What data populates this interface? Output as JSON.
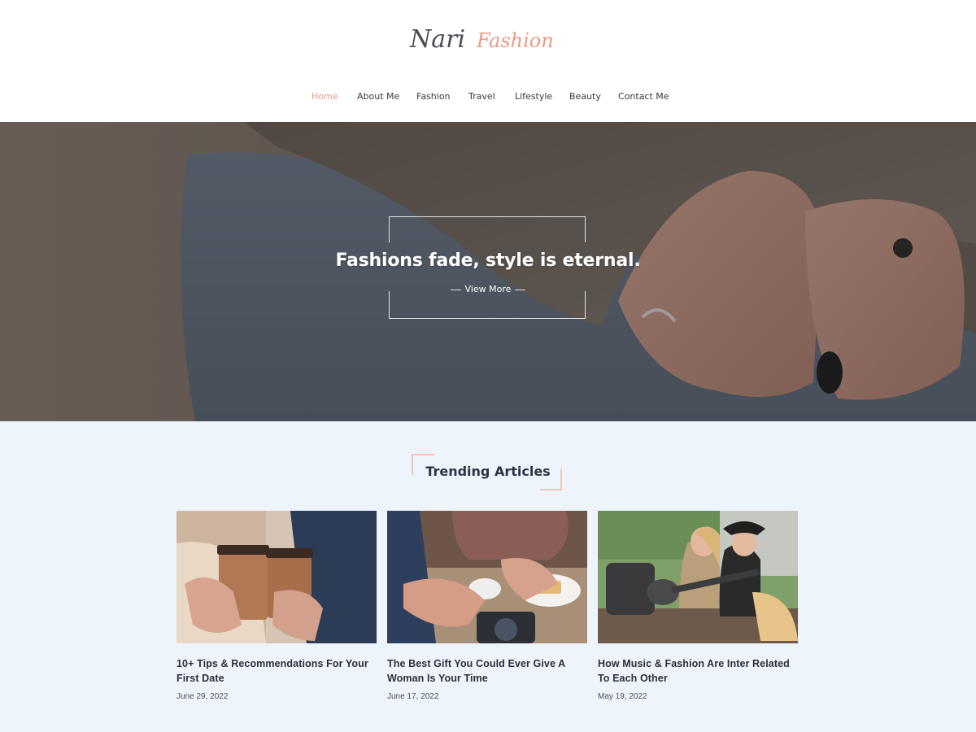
{
  "logo": {
    "text_part1": "Nari",
    "text_part2": "Fashion"
  },
  "nav": {
    "items": [
      {
        "label": "Home",
        "active": true
      },
      {
        "label": "About Me",
        "active": false
      },
      {
        "label": "Fashion",
        "active": false
      },
      {
        "label": "Travel",
        "active": false
      },
      {
        "label": "Lifestyle",
        "active": false
      },
      {
        "label": "Beauty",
        "active": false
      },
      {
        "label": "Contact Me",
        "active": false
      }
    ]
  },
  "hero": {
    "title": "Fashions fade, style is eternal.",
    "cta_label": "View More",
    "image": "hands-with-rings-over-jeans"
  },
  "trending": {
    "heading": "Trending Articles",
    "articles": [
      {
        "title": "10+ Tips & Recommendations For Your First Date",
        "date": "June 29, 2022",
        "image": "couple-holding-coffee-cups"
      },
      {
        "title": "The Best Gift You Could Ever Give A Woman Is Your Time",
        "date": "June 17, 2022",
        "image": "hands-on-table-with-cup-and-camera"
      },
      {
        "title": "How Music & Fashion Are Inter Related To Each Other",
        "date": "May 19, 2022",
        "image": "two-women-with-guitar"
      }
    ]
  },
  "colors": {
    "accent": "#ec9a83",
    "trending_bg": "#eef4fc",
    "text_dark": "#2a2f38"
  }
}
